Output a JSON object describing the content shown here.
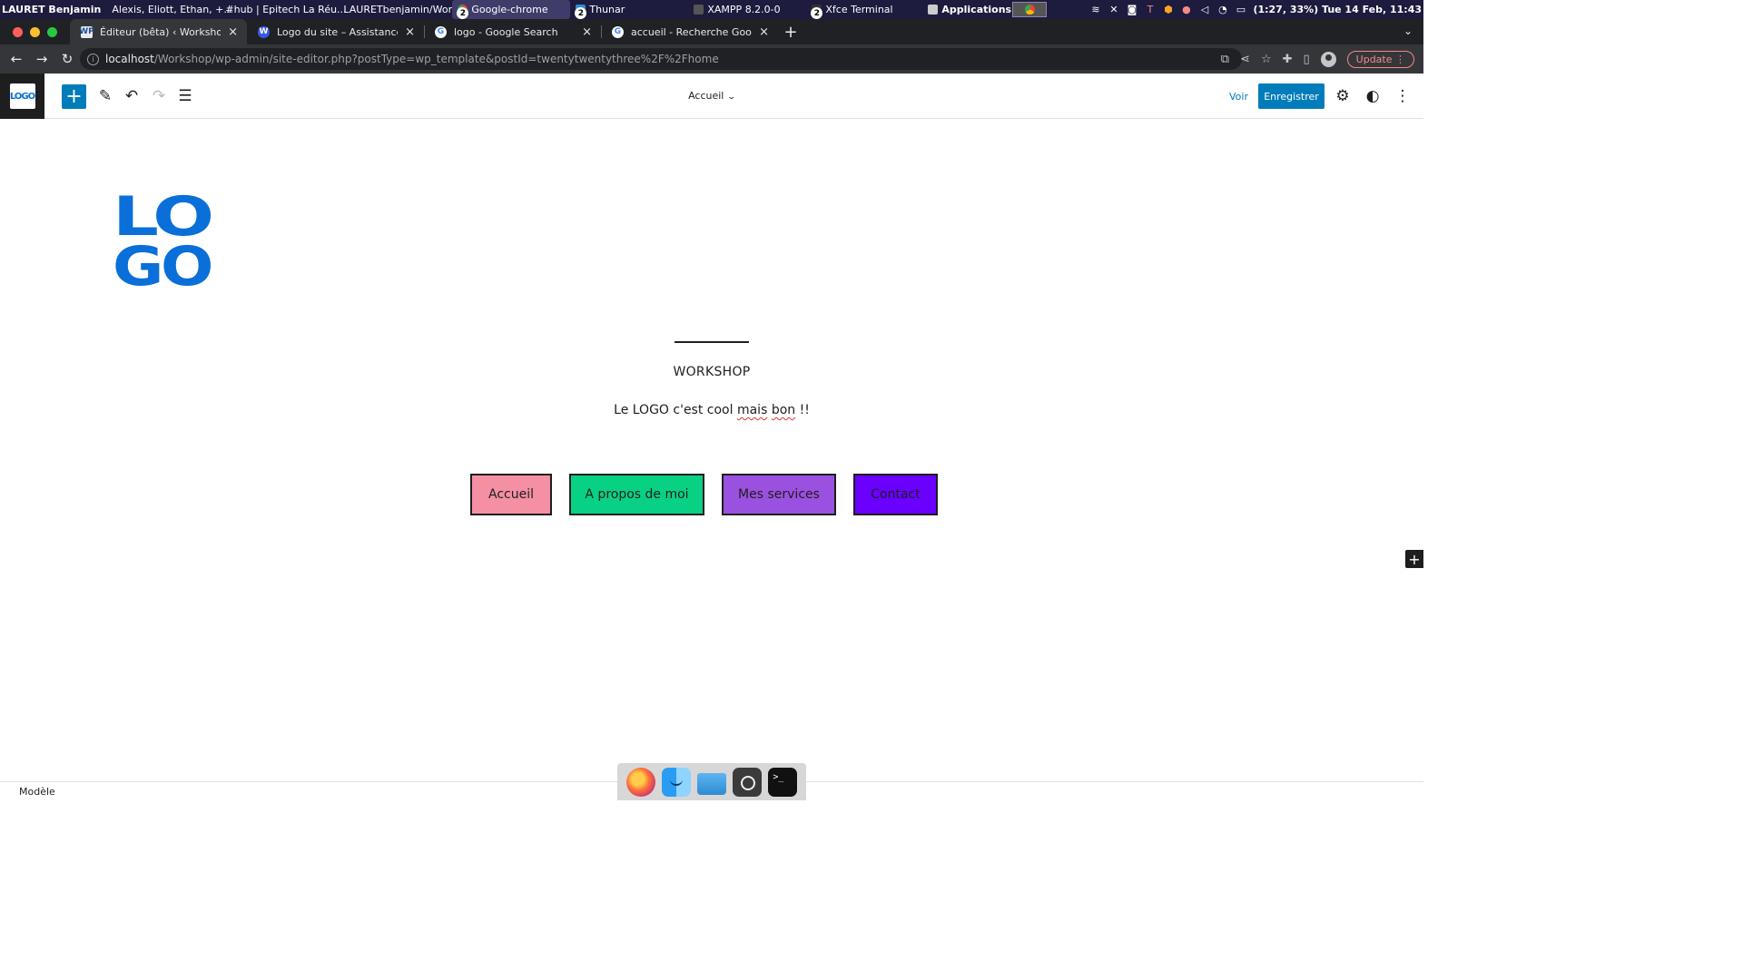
{
  "panel": {
    "user": "LAURET Benjamin",
    "windows": [
      {
        "label": "Alexis, Eliott, Ethan, +...",
        "color": "#5865f2"
      },
      {
        "label": "#hub | Epitech La Réu...",
        "color": "#5865f2"
      },
      {
        "label": "LAURETbenjamin/Wor...",
        "color": "#ff7139"
      },
      {
        "label": "Google-chrome",
        "color": "#ea4335",
        "badge": "2",
        "active": true
      },
      {
        "label": "Thunar",
        "color": "#2f8bd3",
        "badge": "2"
      },
      {
        "label": "XAMPP 8.2.0-0",
        "color": "#555555"
      },
      {
        "label": "Xfce Terminal",
        "color": "#333333",
        "badge": "2"
      }
    ],
    "apps_label": "Applications",
    "clock": "(1:27, 33%) Tue 14 Feb, 11:43"
  },
  "browser": {
    "tabs": [
      {
        "title": "Éditeur (bêta) ‹ Workshop_BENJ",
        "favicon": "WP",
        "active": true
      },
      {
        "title": "Logo du site – Assistance",
        "favicon": "W"
      },
      {
        "title": "logo - Google Search",
        "favicon": "G"
      },
      {
        "title": "accueil - Recherche Google",
        "favicon": "G"
      }
    ],
    "url_host": "localhost",
    "url_path": "/Workshop/wp-admin/site-editor.php?postType=wp_template&postId=twentytwentythree%2F%2Fhome",
    "update_label": "Update"
  },
  "editor": {
    "logo_text": "LOGO",
    "doc_title": "Accueil",
    "view_label": "Voir",
    "save_label": "Enregistrer",
    "footer_label": "Modèle"
  },
  "site": {
    "logo_line1": "LO",
    "logo_line2": "GO",
    "title": "WORKSHOP",
    "tagline_before": "Le LOGO c'est cool ",
    "tagline_word1": "mais",
    "tagline_space": " ",
    "tagline_word2": "bon",
    "tagline_after": " !!",
    "nav": [
      {
        "label": "Accueil",
        "color": "#f48fa4"
      },
      {
        "label": "A propos de moi",
        "color": "#08d184"
      },
      {
        "label": "Mes services",
        "color": "#9b51e0"
      },
      {
        "label": "Contact",
        "color": "#6a00ff"
      }
    ]
  },
  "dock": [
    "firefox-icon",
    "finder-icon",
    "files-icon",
    "screenshot-icon",
    "terminal-icon"
  ],
  "colors": {
    "wp_accent": "#007cba",
    "logo_blue": "#0a6fd8",
    "panel_bg": "#1d1b3e",
    "chrome_dark": "#202124"
  }
}
